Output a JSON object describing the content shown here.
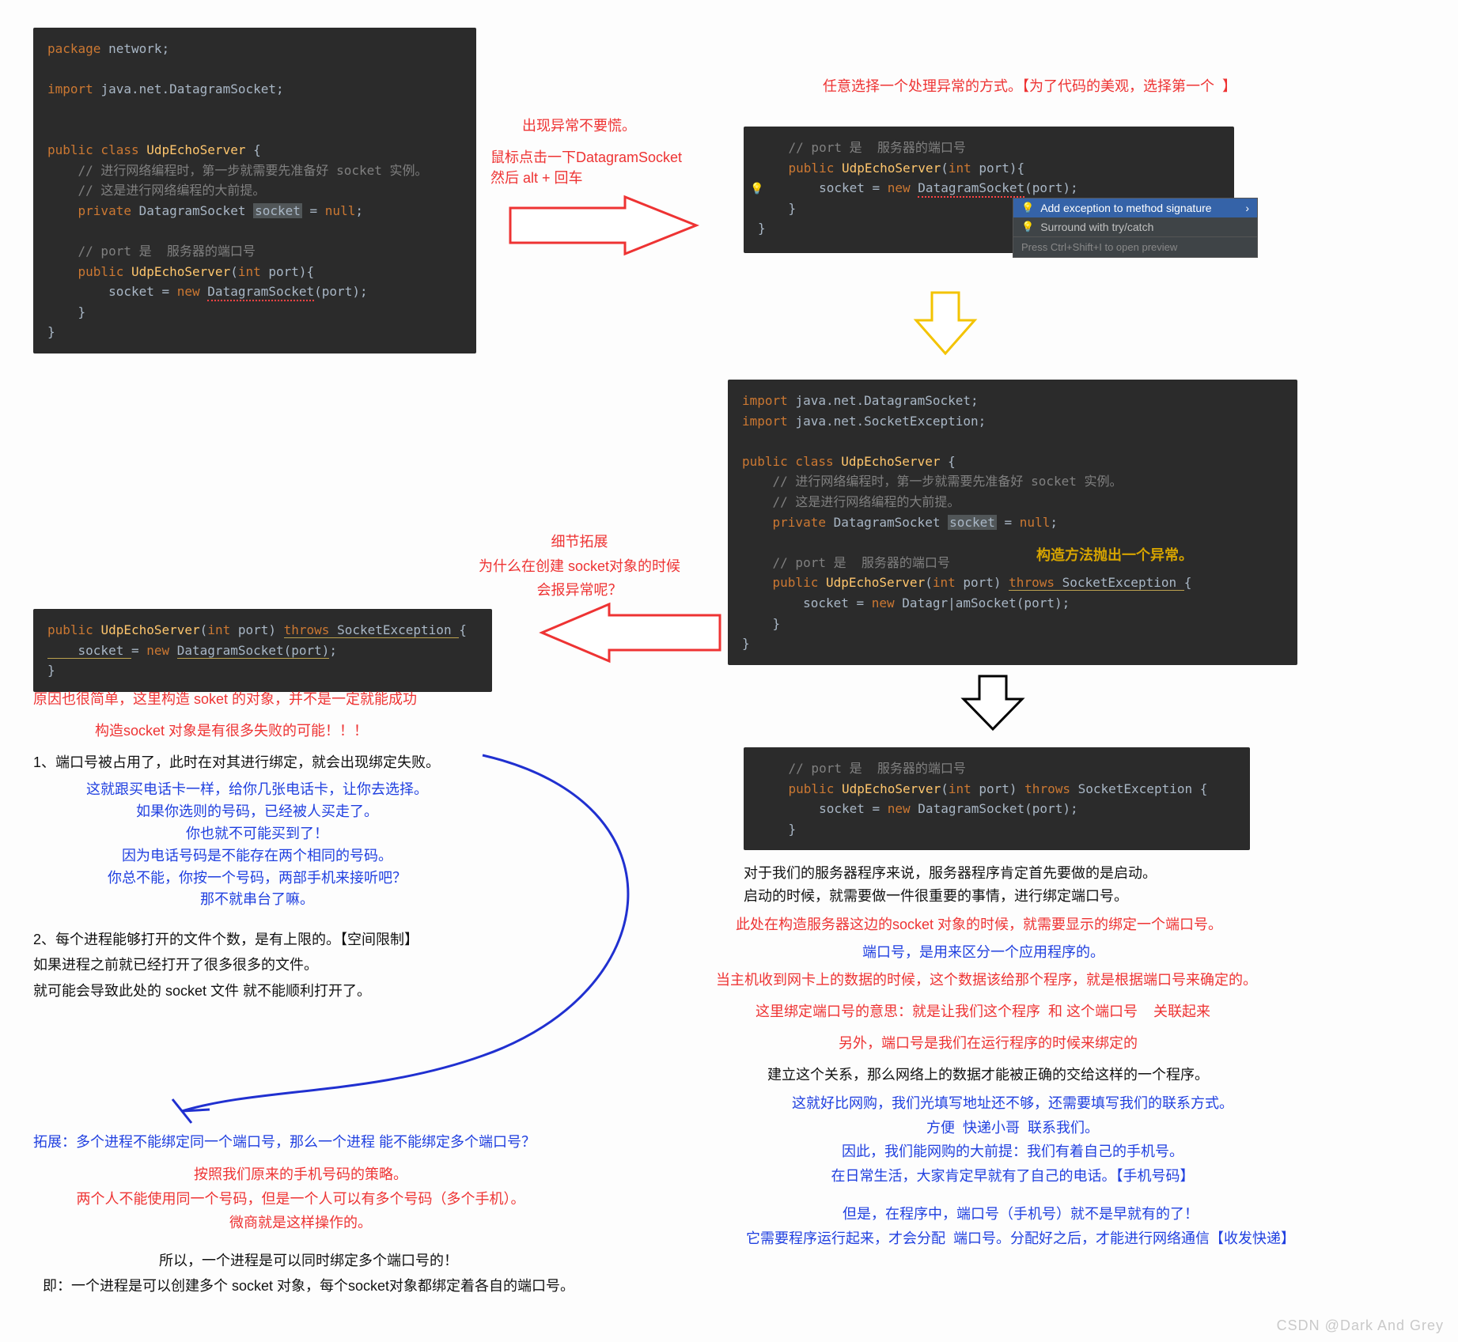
{
  "code1": {
    "l1a": "package ",
    "l1b": "network",
    "l2a": "import ",
    "l2b": "java.net.DatagramSocket",
    "l3a": "public class ",
    "l3b": "UdpEchoServer ",
    "l3c": "{",
    "c1": "    // 进行网络编程时，第一步就需要先准备好 socket 实例。",
    "c2": "    // 这是进行网络编程的大前提。",
    "l4a": "    private ",
    "l4b": "DatagramSocket ",
    "l4c": "socket",
    "l4d": " = ",
    "l4e": "null",
    "l4f": ";",
    "c3": "    // port 是  服务器的端口号",
    "l5a": "    public ",
    "l5b": "UdpEchoServer",
    "l5c": "(",
    "l5d": "int ",
    "l5e": "port",
    "l5f": "){",
    "l6a": "        socket = ",
    "l6b": "new ",
    "l6c": "DatagramSocket",
    "l6d": "(port);",
    "l7": "    }",
    "l8": "}"
  },
  "ann1a": "出现异常不要慌。",
  "ann1b": "鼠标点击一下DatagramSocket\n然后 alt + 回车",
  "topRight": "任意选择一个处理异常的方式。【为了代码的美观，选择第一个  】",
  "code2": {
    "c1": "    // port 是  服务器的端口号",
    "l1a": "    public ",
    "l1b": "UdpEchoServer",
    "l1c": "(",
    "l1d": "int ",
    "l1e": "port",
    "l1f": "){",
    "l2a": "        socket = ",
    "l2b": "new ",
    "l2c": "DatagramSocket",
    "l2d": "(port);",
    "l3": "    }",
    "l4": "}"
  },
  "qf": {
    "opt1": "Add exception to method signature",
    "opt2": "Surround with try/catch",
    "hint": "Press Ctrl+Shift+I to open preview"
  },
  "annConstruct": "构造方法抛出一个异常。",
  "code3": {
    "l1a": "import ",
    "l1b": "java.net.DatagramSocket",
    "l2a": "import ",
    "l2b": "java.net.SocketException",
    "l3a": "public class ",
    "l3b": "UdpEchoServer ",
    "l3c": "{",
    "c1": "    // 进行网络编程时，第一步就需要先准备好 socket 实例。",
    "c2": "    // 这是进行网络编程的大前提。",
    "l4a": "    private ",
    "l4b": "DatagramSocket ",
    "l4c": "socket",
    "l4d": " = ",
    "l4e": "null",
    "l4f": ";",
    "c3": "    // port 是  服务器的端口号",
    "l5a": "    public ",
    "l5b": "UdpEchoServer",
    "l5c": "(",
    "l5d": "int ",
    "l5e": "port",
    "l5f": ") ",
    "l5g": "throws ",
    "l5h": "SocketException ",
    "l5i": "{",
    "l6a": "        socket = ",
    "l6b": "new ",
    "l6c": "Datagr|amSocket",
    "l6d": "(port);",
    "l7": "    }",
    "l8": "}"
  },
  "code4": {
    "c1": "    // port 是  服务器的端口号",
    "l1a": "    public ",
    "l1b": "UdpEchoServer",
    "l1c": "(",
    "l1d": "int ",
    "l1e": "port",
    "l1f": ") ",
    "l1g": "throws ",
    "l1h": "SocketException ",
    "l1i": "{",
    "l2a": "        socket = ",
    "l2b": "new ",
    "l2c": "DatagramSocket",
    "l2d": "(port);",
    "l3": "    }"
  },
  "code5": {
    "l1a": "public ",
    "l1b": "UdpEchoServer",
    "l1c": "(",
    "l1d": "int ",
    "l1e": "port",
    "l1f": ") ",
    "l1g": "throws ",
    "l1h": "SocketException ",
    "l1i": "{",
    "l2a": "    socket ",
    "l2b": "= ",
    "l2c": "new ",
    "l2d": "DatagramSocket",
    "l2e": "(port)",
    "l2f": ";",
    "l3": "}"
  },
  "detailTitle": "细节拓展\n为什么在创建 socket对象的时候\n会报异常呢？",
  "leftBlock": {
    "p1": "原因也很简单，这里构造 soket 的对象，并不是一定就能成功",
    "p2": "构造socket 对象是有很多失败的可能！！！",
    "li1": "1、端口号被占用了，此时在对其进行绑定，就会出现绑定失败。",
    "li1b": "这就跟买电话卡一样，给你几张电话卡，让你去选择。\n如果你选则的号码，已经被人买走了。\n你也就不可能买到了！\n因为电话号码是不能存在两个相同的号码。\n你总不能，你按一个号码，两部手机来接听吧？\n那不就串台了嘛。",
    "li2": "2、每个进程能够打开的文件个数，是有上限的。【空间限制】\n如果进程之前就已经打开了很多很多的文件。\n就可能会导致此处的 socket 文件 就不能顺利打开了。",
    "ext1": "拓展：多个进程不能绑定同一个端口号，那么一个进程 能不能绑定多个端口号？",
    "ext2": "按照我们原来的手机号码的策略。\n两个人不能使用同一个号码，但是一个人可以有多个号码（多个手机）。\n微商就是这样操作的。",
    "ext3": "所以，一个进程是可以同时绑定多个端口号的！\n即：一个进程是可以创建多个 socket 对象，每个socket对象都绑定着各自的端口号。"
  },
  "rightBlock": {
    "p1": "对于我们的服务器程序来说，服务器程序肯定首先要做的是启动。\n启动的时候，就需要做一件很重要的事情，进行绑定端口号。",
    "p2": "此处在构造服务器这边的socket 对象的时候，就需要显示的绑定一个端口号。",
    "p3": "端口号，是用来区分一个应用程序的。",
    "p4": "当主机收到网卡上的数据的时候，这个数据该给那个程序，就是根据端口号来确定的。",
    "p5": "这里绑定端口号的意思：就是让我们这个程序  和 这个端口号    关联起来",
    "p6": "另外，端口号是我们在运行程序的时候来绑定的",
    "p7": "建立这个关系，那么网络上的数据才能被正确的交给这样的一个程序。",
    "p8": "这就好比网购，我们光填写地址还不够，还需要填写我们的联系方式。\n方便  快递小哥  联系我们。\n因此，我们能网购的大前提：我们有着自己的手机号。\n在日常生活，大家肯定早就有了自己的电话。【手机号码】",
    "p9": "但是，在程序中，端口号（手机号）就不是早就有的了！\n它需要程序运行起来，才会分配  端口号。分配好之后，才能进行网络通信【收发快递】"
  },
  "watermark": "CSDN @Dark And Grey"
}
